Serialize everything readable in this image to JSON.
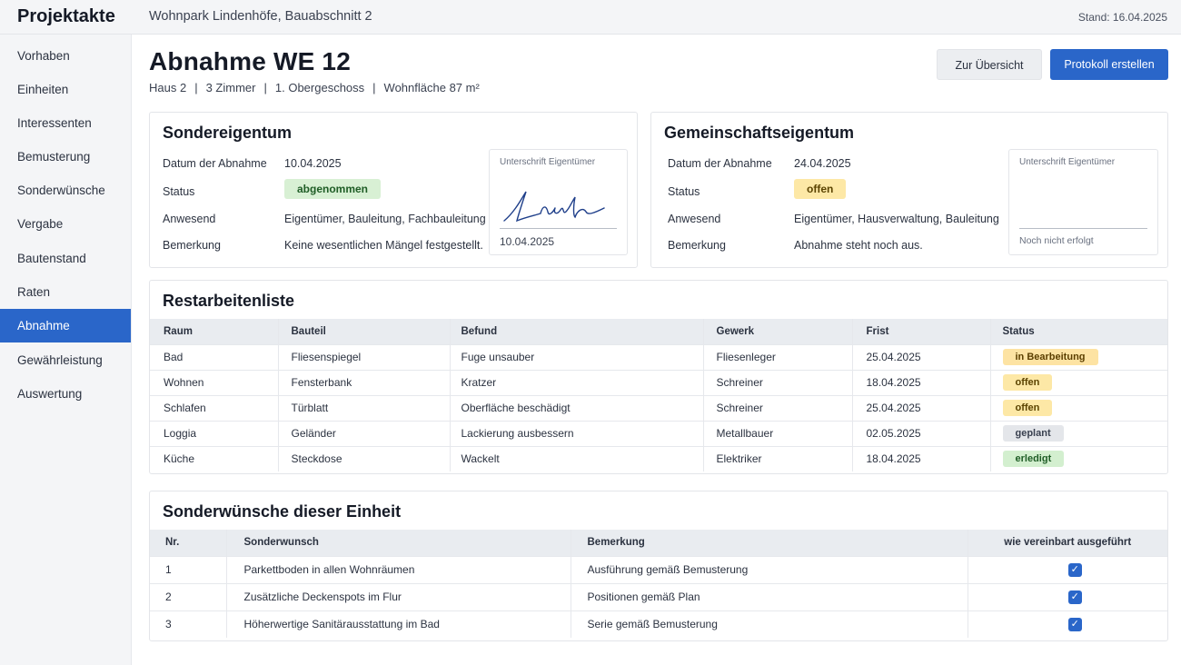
{
  "app": {
    "title": "Projektakte",
    "project": "Wohnpark Lindenhöfe, Bauabschnitt 2",
    "stand": "Stand: 16.04.2025"
  },
  "nav": [
    {
      "label": "Vorhaben"
    },
    {
      "label": "Einheiten"
    },
    {
      "label": "Interessenten"
    },
    {
      "label": "Bemusterung"
    },
    {
      "label": "Sonderwünsche"
    },
    {
      "label": "Vergabe"
    },
    {
      "label": "Bautenstand"
    },
    {
      "label": "Raten"
    },
    {
      "label": "Abnahme"
    },
    {
      "label": "Gewährleistung"
    },
    {
      "label": "Auswertung"
    }
  ],
  "active_nav": "Abnahme",
  "header": {
    "title": "Abnahme WE 12",
    "sub": [
      "Haus 2",
      "3 Zimmer",
      "1. Obergeschoss",
      "Wohnfläche 87 m²"
    ],
    "separator": "|",
    "btn_overview": "Zur Übersicht",
    "btn_protocol": "Protokoll erstellen"
  },
  "sonder": {
    "title": "Sondereigentum",
    "date_label": "Datum der Abnahme",
    "date": "10.04.2025",
    "status_label": "Status",
    "status": "abgenommen",
    "present_label": "Anwesend",
    "present": "Eigentümer, Bauleitung, Fachbauleitung",
    "note_label": "Bemerkung",
    "note": "Keine wesentlichen Mängel festgestellt.",
    "sig_caption": "Unterschrift Eigentümer",
    "sig_date": "10.04.2025",
    "status_color": "#d8f0d4"
  },
  "gemein": {
    "title": "Gemeinschaftseigentum",
    "date_label": "Datum der Abnahme",
    "date": "24.04.2025",
    "status_label": "Status",
    "status": "offen",
    "present_label": "Anwesend",
    "present": "Eigentümer, Hausverwaltung, Bauleitung",
    "note_label": "Bemerkung",
    "note": "Abnahme steht noch aus.",
    "sig_caption": "Unterschrift Eigentümer",
    "sig_foot": "Noch nicht erfolgt",
    "status_color": "#fde8a6"
  },
  "rest": {
    "title": "Restarbeitenliste",
    "headers": [
      "Raum",
      "Bauteil",
      "Befund",
      "Gewerk",
      "Frist",
      "Status"
    ],
    "rows": [
      {
        "raum": "Bad",
        "bauteil": "Fliesenspiegel",
        "befund": "Fuge unsauber",
        "gewerk": "Fliesenleger",
        "frist": "25.04.2025",
        "status": "in Bearbeitung",
        "tone": "orange"
      },
      {
        "raum": "Wohnen",
        "bauteil": "Fensterbank",
        "befund": "Kratzer",
        "gewerk": "Schreiner",
        "frist": "18.04.2025",
        "status": "offen",
        "tone": "yellow"
      },
      {
        "raum": "Schlafen",
        "bauteil": "Türblatt",
        "befund": "Oberfläche beschädigt",
        "gewerk": "Schreiner",
        "frist": "25.04.2025",
        "status": "offen",
        "tone": "yellow"
      },
      {
        "raum": "Loggia",
        "bauteil": "Geländer",
        "befund": "Lackierung ausbessern",
        "gewerk": "Metallbauer",
        "frist": "02.05.2025",
        "status": "geplant",
        "tone": "grey"
      },
      {
        "raum": "Küche",
        "bauteil": "Steckdose",
        "befund": "Wackelt",
        "gewerk": "Elektriker",
        "frist": "18.04.2025",
        "status": "erledigt",
        "tone": "green"
      }
    ]
  },
  "wishes": {
    "title": "Sonderwünsche dieser Einheit",
    "headers": [
      "Nr.",
      "Sonderwunsch",
      "Bemerkung",
      "wie vereinbart ausgeführt"
    ],
    "rows": [
      {
        "nr": "1",
        "wish": "Parkettboden in allen Wohnräumen",
        "note": "Ausführung gemäß Bemusterung",
        "done": true
      },
      {
        "nr": "2",
        "wish": "Zusätzliche Deckenspots im Flur",
        "note": "Positionen gemäß Plan",
        "done": true
      },
      {
        "nr": "3",
        "wish": "Höherwertige Sanitärausstattung im Bad",
        "note": "Serie gemäß Bemusterung",
        "done": true
      }
    ]
  },
  "colors": {
    "accent": "#2a66c9",
    "sidebar": "#f4f5f7"
  }
}
